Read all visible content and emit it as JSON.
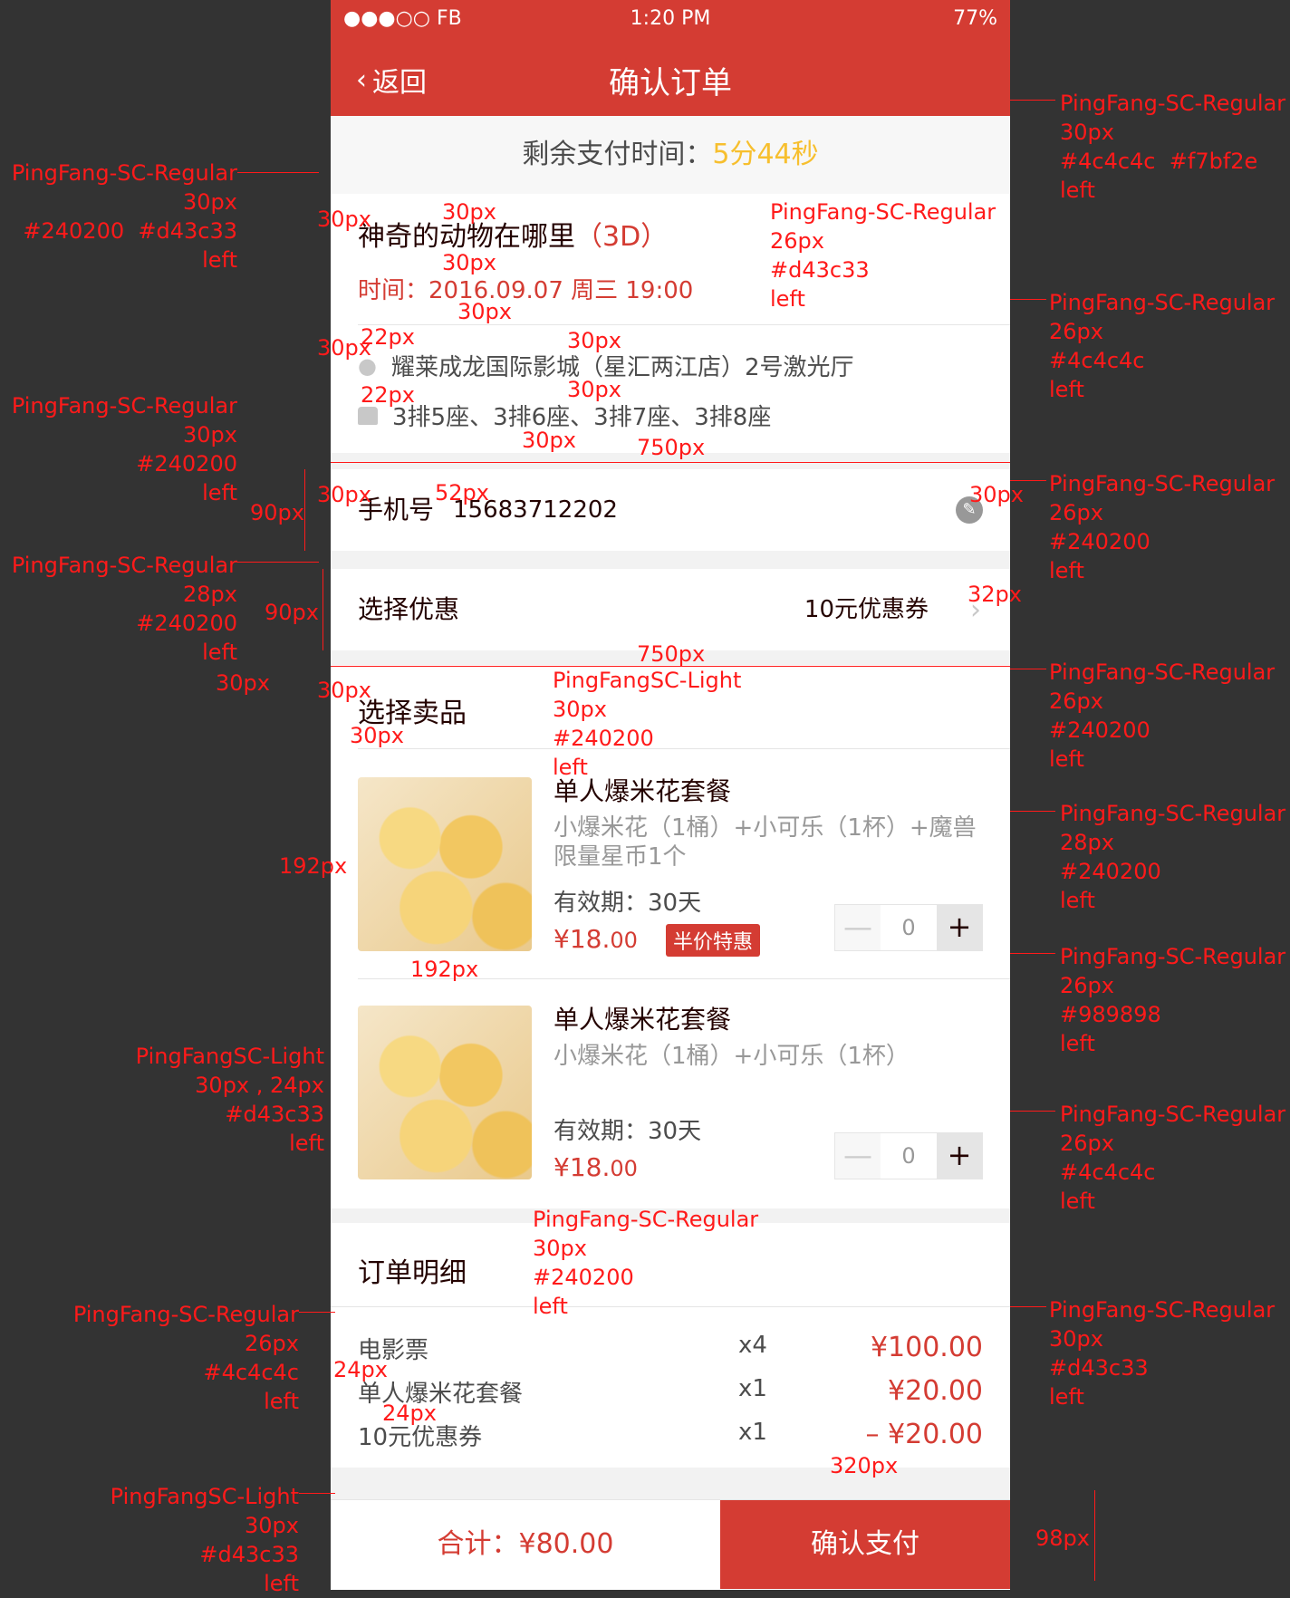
{
  "status": {
    "carrier": "●●●○○ FB",
    "time": "1:20 PM",
    "battery": "77%"
  },
  "nav": {
    "back_label": "返回",
    "title": "确认订单"
  },
  "timer": {
    "label": "剩余支付时间：",
    "value": "5分44秒"
  },
  "movie": {
    "title": "神奇的动物在哪里",
    "format": "（3D）",
    "time": "时间：2016.09.07 周三 19:00"
  },
  "cinema": {
    "name": "耀莱成龙国际影城（星汇两江店）2号激光厅",
    "seats": "3排5座、3排6座、3排7座、3排8座"
  },
  "phone": {
    "label": "手机号",
    "value": "15683712202"
  },
  "coupon": {
    "label": "选择优惠",
    "value": "10元优惠券"
  },
  "products": {
    "section_title": "选择卖品",
    "items": [
      {
        "name": "单人爆米花套餐",
        "desc": "小爆米花（1桶）+小可乐（1杯）+魔兽限量星币1个",
        "validity": "有效期：30天",
        "price_main": "¥18.",
        "price_cents": "00",
        "badge": "半价特惠",
        "qty": "0",
        "minus": "—",
        "plus": "+"
      },
      {
        "name": "单人爆米花套餐",
        "desc": "小爆米花（1桶）+小可乐（1杯）",
        "validity": "有效期：30天",
        "price_main": "¥18.",
        "price_cents": "00",
        "qty": "0",
        "minus": "—",
        "plus": "+"
      }
    ]
  },
  "detail": {
    "title": "订单明细",
    "rows": [
      {
        "name": "电影票",
        "qty": "x4",
        "price": "¥100.00"
      },
      {
        "name": "单人爆米花套餐",
        "qty": "x1",
        "price": "¥20.00"
      },
      {
        "name": "10元优惠券",
        "qty": "x1",
        "price": "– ¥20.00"
      }
    ]
  },
  "footer": {
    "total": "合计：¥80.00",
    "pay": "确认支付"
  },
  "annotations": {
    "a1": "PingFang-SC-Regular\n30px\n#4c4c4c  #f7bf2e\nleft",
    "a2": "PingFang-SC-Regular\n30px\n#240200  #d43c33\nleft",
    "a3": "PingFang-SC-Regular\n26px\n#d43c33\nleft",
    "a4": "PingFang-SC-Regular\n26px\n#4c4c4c\nleft",
    "a5": "PingFang-SC-Regular\n30px\n#240200\nleft",
    "a6": "PingFang-SC-Regular\n26px\n#240200\nleft",
    "a7": "PingFang-SC-Regular\n28px\n#240200\nleft",
    "a8": "PingFang-SC-Regular\n26px\n#240200\nleft",
    "a9": "PingFangSC-Light\n30px\n#240200\nleft",
    "a10": "PingFang-SC-Regular\n28px\n#240200\nleft",
    "a11": "PingFang-SC-Regular\n26px\n#989898\nleft",
    "a12": "PingFangSC-Light\n30px , 24px\n#d43c33\nleft",
    "a13": "PingFang-SC-Regular\n26px\n#4c4c4c\nleft",
    "a14": "PingFang-SC-Regular\n30px\n#240200\nleft",
    "a15": "PingFang-SC-Regular\n26px\n#4c4c4c\nleft",
    "a16": "PingFang-SC-Regular\n30px\n#d43c33\nleft",
    "a17": "PingFangSC-Light\n30px\n#d43c33\nleft",
    "m30": "30px",
    "m22": "22px",
    "m52": "52px",
    "m32": "32px",
    "m24": "24px",
    "m90": "90px",
    "m750": "750px",
    "m192": "192px",
    "m320": "320px",
    "m98": "98px"
  },
  "colors": {
    "primary": "#d43c33",
    "text": "#240200",
    "secondary": "#4c4c4c",
    "muted": "#989898",
    "timer": "#f7bf2e"
  }
}
